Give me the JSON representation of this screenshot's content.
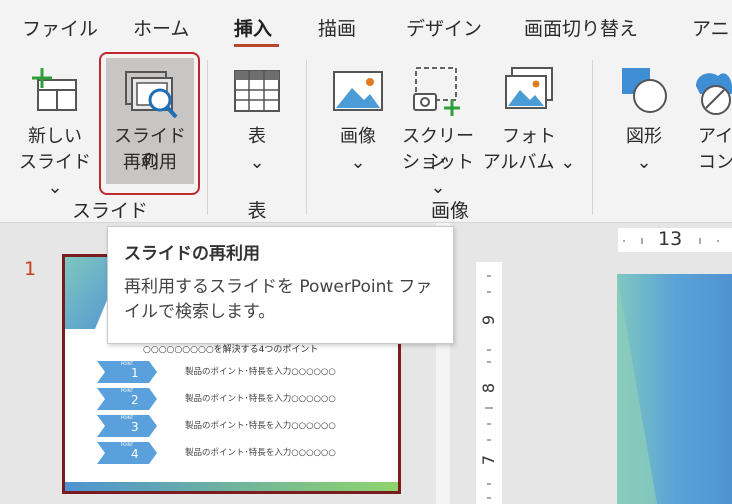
{
  "tabs": [
    {
      "label": "ファイル"
    },
    {
      "label": "ホーム"
    },
    {
      "label": "挿入"
    },
    {
      "label": "描画"
    },
    {
      "label": "デザイン"
    },
    {
      "label": "画面切り替え"
    },
    {
      "label": "アニメ"
    }
  ],
  "ribbon": {
    "new_slide": {
      "line1": "新しい",
      "line2": "スライド ⌄"
    },
    "reuse_slides": {
      "line1": "スライドの",
      "line2": "再利用"
    },
    "table": {
      "line1": "表",
      "line2": "⌄"
    },
    "image": {
      "line1": "画像",
      "line2": "⌄"
    },
    "screenshot": {
      "line1": "スクリーン",
      "line2": "ショット ⌄"
    },
    "photo_album": {
      "line1": "フォト",
      "line2": "アルバム ⌄"
    },
    "shapes": {
      "line1": "図形",
      "line2": "⌄"
    },
    "icons": {
      "line1": "アイ",
      "line2": "コン"
    },
    "groups": {
      "slides": "スライド",
      "tables": "表",
      "images": "画像"
    }
  },
  "tooltip": {
    "title": "スライドの再利用",
    "body": "再利用するスライドを PowerPoint ファイルで検索します。"
  },
  "thumbnail": {
    "number": "1",
    "heading": "○○○○○○○○○を解決する4つのポイント",
    "point_tag": "POINT",
    "points": [
      {
        "num": "1",
        "text": "製品のポイント･特長を入力○○○○○○"
      },
      {
        "num": "2",
        "text": "製品のポイント･特長を入力○○○○○○"
      },
      {
        "num": "3",
        "text": "製品のポイント･特長を入力○○○○○○"
      },
      {
        "num": "4",
        "text": "製品のポイント･特長を入力○○○○○○"
      }
    ]
  },
  "rulers": {
    "horizontal_label": "13",
    "vertical_labels": [
      "9",
      "8",
      "7"
    ]
  },
  "colors": {
    "accent": "#b7472a",
    "highlight_border": "#c0282f",
    "slide_number": "#c43e1c",
    "thumb_border": "#7a1b20"
  }
}
